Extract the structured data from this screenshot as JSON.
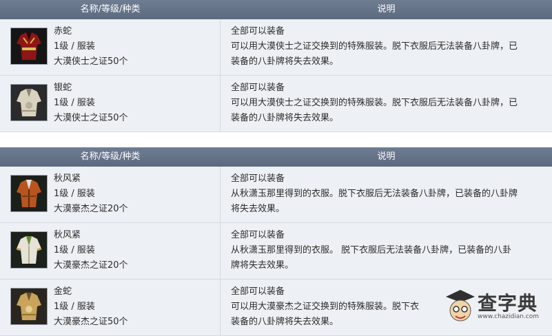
{
  "tables": [
    {
      "header": {
        "col1": "名称/等级/种类",
        "col2": "说明"
      },
      "rows": [
        {
          "name": "赤蛇",
          "level": "1级 / 服装",
          "source": "大漠侠士之证50个",
          "icon": "red-robe-icon",
          "accent": "#a02020",
          "desc": [
            "全部可以装备",
            "可以用大漠侠士之证交换到的特殊服装。脱下衣服后无法装备八卦牌，已",
            "装备的八卦牌将失去效果。"
          ]
        },
        {
          "name": "银蛇",
          "level": "1级 / 服装",
          "source": "大漠侠士之证50个",
          "icon": "silver-robe-icon",
          "accent": "#cfc8b4",
          "desc": [
            "全部可以装备",
            "可以用大漠侠士之证交换到的特殊服装。脱下衣服后无法装备八卦牌，已",
            "装备的八卦牌将失去效果。"
          ]
        }
      ]
    },
    {
      "header": {
        "col1": "名称/等级/种类",
        "col2": "说明"
      },
      "rows": [
        {
          "name": "秋风紧",
          "level": "1级 / 服装",
          "source": "大漠豪杰之证20个",
          "icon": "orange-robe-icon",
          "accent": "#b8551e",
          "desc": [
            "全部可以装备",
            "从秋潇玉那里得到的衣服。脱下衣服后无法装备八卦牌，已装备的八卦牌",
            "将失去效果。"
          ]
        },
        {
          "name": "秋风紧",
          "level": "1级 / 服装",
          "source": "大漠豪杰之证20个",
          "icon": "white-robe-icon",
          "accent": "#e6e2d6",
          "desc": [
            "全部可以装备",
            "从秋潇玉那里得到的衣服。 脱下衣服后无法装备八卦牌，已装备的八卦",
            "牌将失去效果。"
          ]
        },
        {
          "name": "金蛇",
          "level": "1级 / 服装",
          "source": "大漠豪杰之证50个",
          "icon": "gold-robe-icon",
          "accent": "#c9a45a",
          "desc": [
            "全部可以装备",
            "可以用大漠豪杰之证交换到的特殊服装。脱下衣",
            "装备的八卦牌将失去效果。"
          ]
        }
      ]
    }
  ],
  "watermark": {
    "text": "查字典",
    "url": "www.chazidian.com"
  }
}
